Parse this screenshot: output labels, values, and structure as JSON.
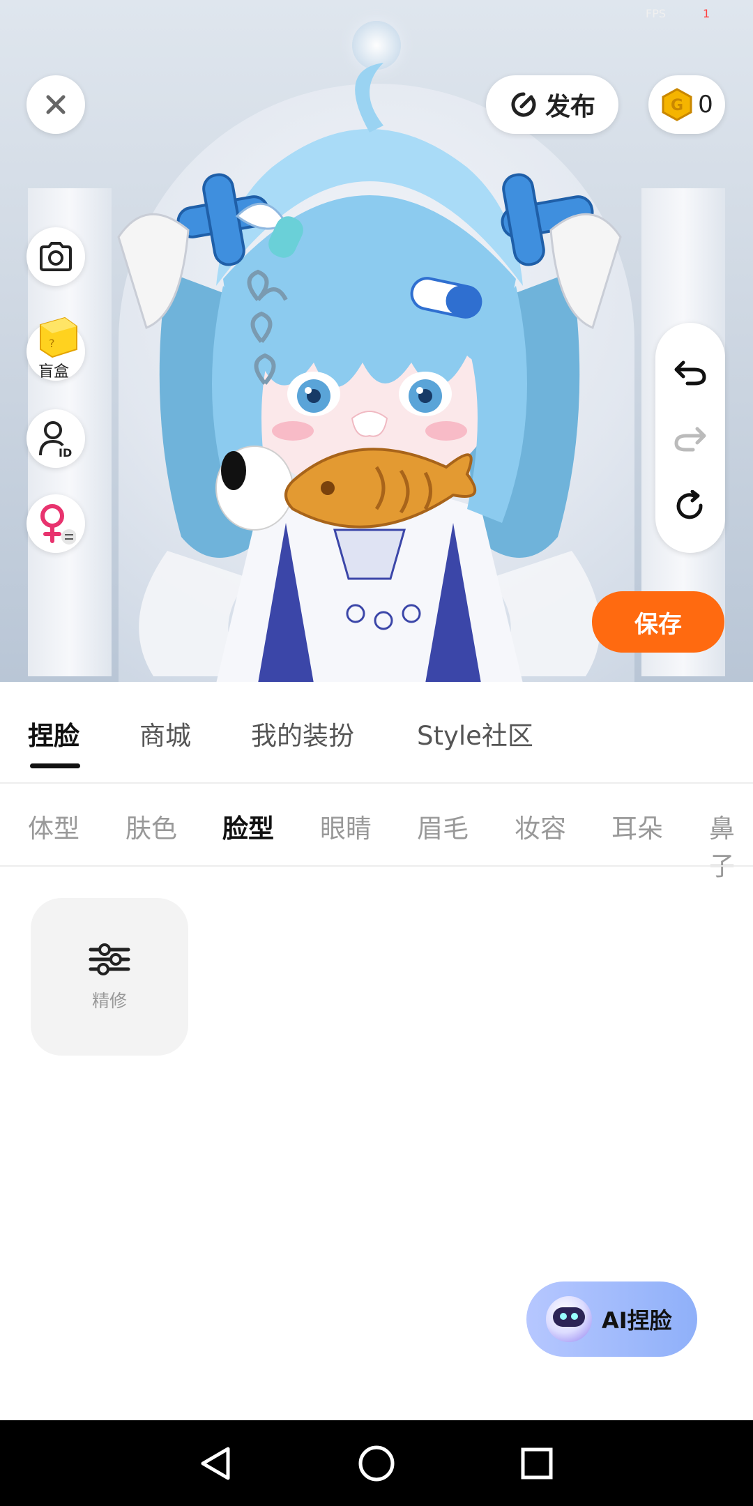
{
  "status": {
    "fps_label": "FPS",
    "fps_value": "1"
  },
  "top_bar": {
    "publish_label": "发布",
    "coin_count": "0"
  },
  "side_buttons": {
    "blind_box_label": "盲盒"
  },
  "actions": {
    "save_label": "保存"
  },
  "tabs": [
    {
      "label": "捏脸",
      "active": true
    },
    {
      "label": "商城",
      "active": false
    },
    {
      "label": "我的装扮",
      "active": false
    },
    {
      "label": "Style社区",
      "active": false
    }
  ],
  "subtabs": [
    {
      "label": "体型",
      "active": false
    },
    {
      "label": "肤色",
      "active": false
    },
    {
      "label": "脸型",
      "active": true
    },
    {
      "label": "眼睛",
      "active": false
    },
    {
      "label": "眉毛",
      "active": false
    },
    {
      "label": "妆容",
      "active": false
    },
    {
      "label": "耳朵",
      "active": false
    },
    {
      "label": "鼻子",
      "active": false
    }
  ],
  "tools": {
    "refine_label": "精修"
  },
  "ai_button": {
    "label": "AI捏脸"
  },
  "colors": {
    "accent": "#ff6a10",
    "ai_gradient_start": "#b6c7ff",
    "ai_gradient_end": "#8fb0f9",
    "coin": "#f5b400"
  }
}
